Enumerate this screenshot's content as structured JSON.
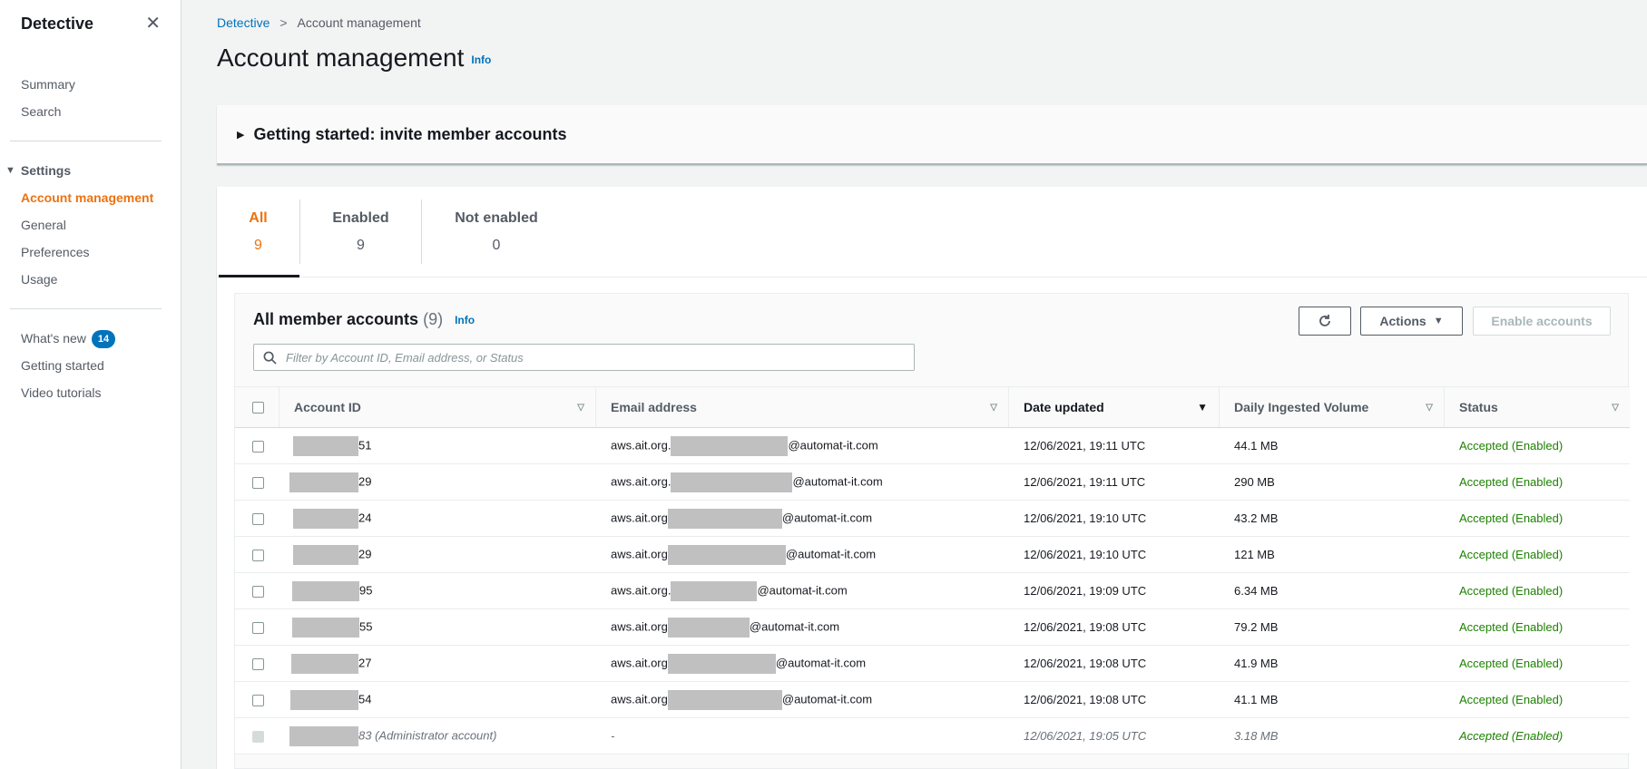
{
  "sidebar": {
    "title": "Detective",
    "items_top": [
      {
        "label": "Summary",
        "name": "sidebar-item-summary"
      },
      {
        "label": "Search",
        "name": "sidebar-item-search"
      }
    ],
    "settings_label": "Settings",
    "settings_items": [
      {
        "label": "Account management",
        "name": "sidebar-item-account-management",
        "active": true
      },
      {
        "label": "General",
        "name": "sidebar-item-general"
      },
      {
        "label": "Preferences",
        "name": "sidebar-item-preferences"
      },
      {
        "label": "Usage",
        "name": "sidebar-item-usage"
      }
    ],
    "whats_new_label": "What's new",
    "whats_new_count": "14",
    "getting_started_label": "Getting started",
    "video_tutorials_label": "Video tutorials"
  },
  "breadcrumb": {
    "root": "Detective",
    "current": "Account management"
  },
  "page": {
    "title": "Account management",
    "info": "Info"
  },
  "expander": {
    "label": "Getting started: invite member accounts"
  },
  "tabs": [
    {
      "label": "All",
      "count": "9"
    },
    {
      "label": "Enabled",
      "count": "9"
    },
    {
      "label": "Not enabled",
      "count": "0"
    }
  ],
  "table_header": {
    "title": "All member accounts",
    "count": "(9)",
    "info": "Info",
    "actions_label": "Actions",
    "enable_label": "Enable accounts",
    "search_placeholder": "Filter by Account ID, Email address, or Status"
  },
  "columns": [
    "Account ID",
    "Email address",
    "Date updated",
    "Daily Ingested Volume",
    "Status"
  ],
  "rows": [
    {
      "id_suffix": "51",
      "email_prefix": "aws.ait.org.",
      "email_domain": "@automat-it.com",
      "date": "12/06/2021, 19:11 UTC",
      "volume": "44.1 MB",
      "status": "Accepted (Enabled)"
    },
    {
      "id_suffix": "29",
      "email_prefix": "aws.ait.org.",
      "email_domain": "@automat-it.com",
      "date": "12/06/2021, 19:11 UTC",
      "volume": "290 MB",
      "status": "Accepted (Enabled)"
    },
    {
      "id_suffix": "24",
      "email_prefix": "aws.ait.org",
      "email_domain": "@automat-it.com",
      "date": "12/06/2021, 19:10 UTC",
      "volume": "43.2 MB",
      "status": "Accepted (Enabled)"
    },
    {
      "id_suffix": "29",
      "email_prefix": "aws.ait.org",
      "email_domain": "@automat-it.com",
      "date": "12/06/2021, 19:10 UTC",
      "volume": "121 MB",
      "status": "Accepted (Enabled)"
    },
    {
      "id_suffix": "95",
      "email_prefix": "aws.ait.org.",
      "email_domain": "@automat-it.com",
      "date": "12/06/2021, 19:09 UTC",
      "volume": "6.34 MB",
      "status": "Accepted (Enabled)"
    },
    {
      "id_suffix": "55",
      "email_prefix": "aws.ait.org",
      "email_domain": "@automat-it.com",
      "date": "12/06/2021, 19:08 UTC",
      "volume": "79.2 MB",
      "status": "Accepted (Enabled)"
    },
    {
      "id_suffix": "27",
      "email_prefix": "aws.ait.org",
      "email_domain": "@automat-it.com",
      "date": "12/06/2021, 19:08 UTC",
      "volume": "41.9 MB",
      "status": "Accepted (Enabled)"
    },
    {
      "id_suffix": "54",
      "email_prefix": "aws.ait.org",
      "email_domain": "@automat-it.com",
      "date": "12/06/2021, 19:08 UTC",
      "volume": "41.1 MB",
      "status": "Accepted (Enabled)"
    }
  ],
  "admin_row": {
    "id_suffix": "83 (Administrator account)",
    "email": "-",
    "date": "12/06/2021, 19:05 UTC",
    "volume": "3.18 MB",
    "status": "Accepted (Enabled)"
  },
  "colors": {
    "accent": "#ec7211",
    "link": "#0073bb",
    "success": "#1d8102",
    "badge": "#0073bb"
  }
}
